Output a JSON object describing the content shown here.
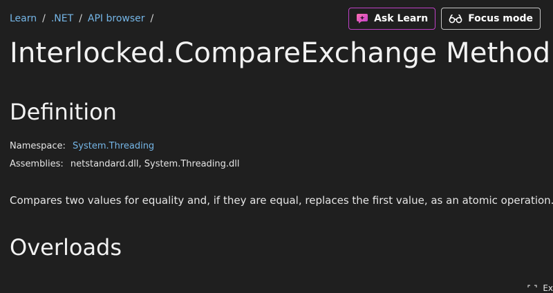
{
  "breadcrumb": {
    "items": [
      "Learn",
      ".NET",
      "API browser"
    ],
    "separator": "/"
  },
  "actions": {
    "ask_label": "Ask Learn",
    "focus_label": "Focus mode",
    "ask_icon": "ask-learn-icon",
    "focus_icon": "glasses-icon"
  },
  "page": {
    "title": "Interlocked.CompareExchange Method"
  },
  "definition": {
    "heading": "Definition",
    "namespace_label": "Namespace:",
    "namespace_value": "System.Threading",
    "assemblies_label": "Assemblies:",
    "assemblies_value": "netstandard.dll, System.Threading.dll",
    "summary": "Compares two values for equality and, if they are equal, replaces the first value, as an atomic operation."
  },
  "overloads": {
    "heading": "Overloads"
  },
  "corner": {
    "text": "Ex",
    "icon": "expand-icon"
  },
  "colors": {
    "background": "#1f1f1f",
    "link": "#75b6e7",
    "ask_border": "#c042c8",
    "text": "#e6e6e6"
  }
}
